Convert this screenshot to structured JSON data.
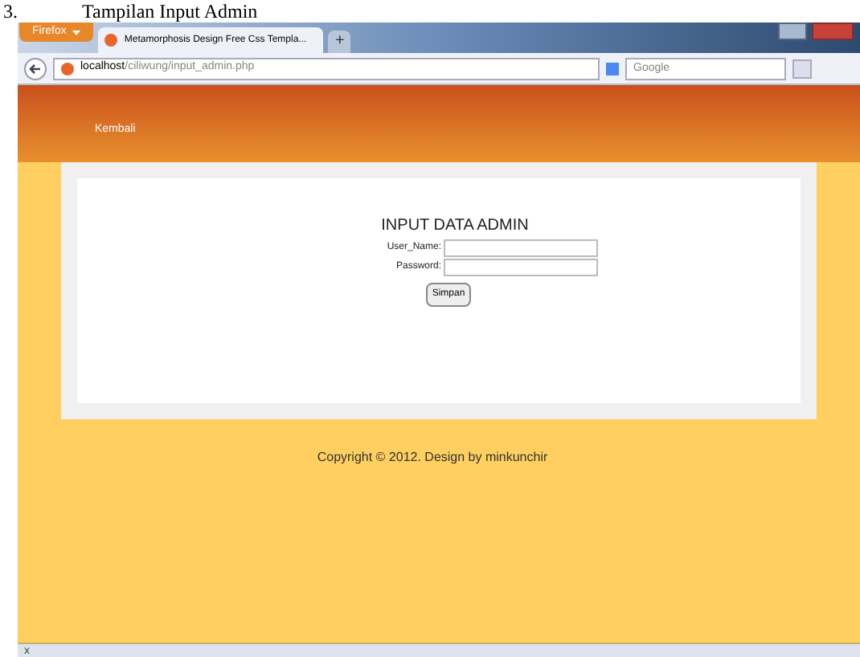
{
  "caption": {
    "number": "3.",
    "text": "Tampilan Input Admin"
  },
  "browser": {
    "menu_button": "Firefox",
    "tabs": [
      {
        "label": "Metamorphosis Design Free Css Templa...",
        "selected": true
      }
    ],
    "new_tab": "+",
    "url_host": "localhost",
    "url_path": "/ciliwung/input_admin.php",
    "search_placeholder": "Google"
  },
  "page": {
    "nav_link": "Kembali",
    "form_title": "INPUT DATA ADMIN",
    "fields": [
      {
        "label": "User_Name:"
      },
      {
        "label": "Password:"
      }
    ],
    "submit": "Simpan",
    "footer": "Copyright © 2012. Design by minkunchir"
  },
  "status_bar": {
    "close": "x"
  }
}
